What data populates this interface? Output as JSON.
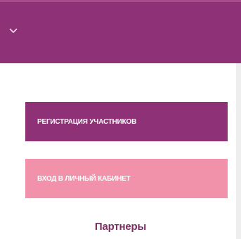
{
  "header": {
    "menu_icon": "chevron-down-icon"
  },
  "actions": {
    "register_label": "РЕГИСТРАЦИЯ УЧАСТНИКОВ",
    "login_label": "ВХОД В ЛИЧНЫЙ КАБИНЕТ"
  },
  "partners": {
    "heading": "Партнеры"
  },
  "colors": {
    "brand_purple": "#8e3177",
    "pink": "#f291aa",
    "heading_purple": "#7a2f63"
  }
}
